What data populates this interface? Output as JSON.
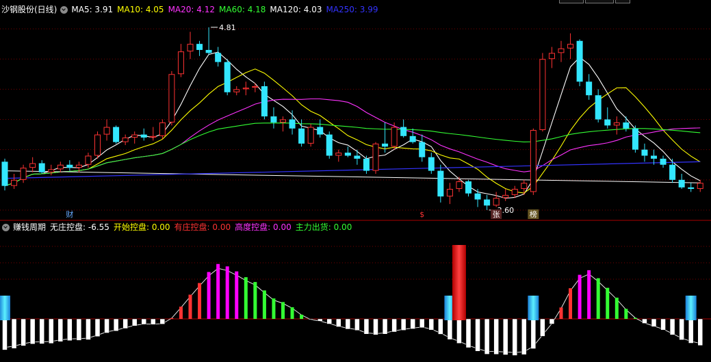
{
  "title": "沙钢股份(日线)",
  "ma_legend": [
    {
      "label": "MA5: 3.91",
      "color": "#ffffff"
    },
    {
      "label": "MA10: 4.05",
      "color": "#ffff00"
    },
    {
      "label": "MA20: 4.12",
      "color": "#ff33ff"
    },
    {
      "label": "MA60: 4.18",
      "color": "#33ff33"
    },
    {
      "label": "MA120: 4.03",
      "color": "#ffffff"
    },
    {
      "label": "MA250: 3.99",
      "color": "#3333ff"
    }
  ],
  "indicator": {
    "name": "赚钱周期",
    "fields": [
      {
        "label": "无庄控盘:",
        "value": "-6.55",
        "color": "#ffffff"
      },
      {
        "label": "开始控盘:",
        "value": "0.00",
        "color": "#ffff00"
      },
      {
        "label": "有庄控盘:",
        "value": "0.00",
        "color": "#ff3333"
      },
      {
        "label": "高度控盘:",
        "value": "0.00",
        "color": "#ff33ff"
      },
      {
        "label": "主力出货:",
        "value": "0.00",
        "color": "#33ff33"
      }
    ]
  },
  "colors": {
    "up": "#ff3333",
    "down": "#33e6ff",
    "grid": "#7a0000",
    "purple": "#ff00ff"
  },
  "chart_data": [
    {
      "type": "candlestick",
      "ylim": [
        3.55,
        4.9
      ],
      "annotations": {
        "high": "4.81",
        "low": "3.60"
      },
      "markers": [
        {
          "index": 7,
          "label": "财",
          "color": "#66aaff"
        },
        {
          "index": 45,
          "label": "$",
          "color": "#ff3333"
        },
        {
          "index": 53,
          "label": "张",
          "color": "#ffffff",
          "bg": "#552222"
        },
        {
          "index": 57,
          "label": "榜",
          "color": "#ffffff",
          "bg": "#665522"
        }
      ],
      "candles": [
        [
          3.92,
          3.94,
          3.73,
          3.76
        ],
        [
          3.76,
          3.84,
          3.74,
          3.8
        ],
        [
          3.8,
          3.9,
          3.78,
          3.88
        ],
        [
          3.88,
          3.95,
          3.85,
          3.91
        ],
        [
          3.91,
          3.93,
          3.84,
          3.85
        ],
        [
          3.85,
          3.9,
          3.83,
          3.87
        ],
        [
          3.87,
          3.92,
          3.85,
          3.9
        ],
        [
          3.9,
          3.93,
          3.86,
          3.88
        ],
        [
          3.88,
          3.92,
          3.85,
          3.9
        ],
        [
          3.9,
          3.98,
          3.88,
          3.96
        ],
        [
          3.96,
          4.12,
          3.94,
          4.1
        ],
        [
          4.1,
          4.2,
          4.06,
          4.15
        ],
        [
          4.15,
          4.16,
          4.04,
          4.05
        ],
        [
          4.05,
          4.1,
          4.03,
          4.08
        ],
        [
          4.08,
          4.12,
          4.04,
          4.1
        ],
        [
          4.1,
          4.14,
          4.06,
          4.08
        ],
        [
          4.08,
          4.15,
          4.06,
          4.09
        ],
        [
          4.09,
          4.2,
          4.07,
          4.18
        ],
        [
          4.18,
          4.52,
          4.16,
          4.5
        ],
        [
          4.5,
          4.7,
          4.48,
          4.65
        ],
        [
          4.65,
          4.78,
          4.6,
          4.7
        ],
        [
          4.7,
          4.72,
          4.62,
          4.66
        ],
        [
          4.66,
          4.81,
          4.63,
          4.64
        ],
        [
          4.64,
          4.68,
          4.55,
          4.58
        ],
        [
          4.58,
          4.6,
          4.36,
          4.38
        ],
        [
          4.38,
          4.42,
          4.36,
          4.4
        ],
        [
          4.4,
          4.45,
          4.36,
          4.41
        ],
        [
          4.41,
          4.44,
          4.38,
          4.42
        ],
        [
          4.42,
          4.45,
          4.2,
          4.22
        ],
        [
          4.22,
          4.28,
          4.14,
          4.18
        ],
        [
          4.18,
          4.22,
          4.12,
          4.2
        ],
        [
          4.2,
          4.26,
          4.1,
          4.14
        ],
        [
          4.14,
          4.2,
          4.02,
          4.04
        ],
        [
          4.04,
          4.17,
          4.02,
          4.15
        ],
        [
          4.15,
          4.2,
          4.08,
          4.1
        ],
        [
          4.1,
          4.12,
          3.94,
          3.96
        ],
        [
          3.96,
          4.0,
          3.92,
          3.98
        ],
        [
          3.98,
          4.02,
          3.95,
          3.96
        ],
        [
          3.96,
          4.0,
          3.9,
          3.94
        ],
        [
          3.94,
          3.96,
          3.84,
          3.86
        ],
        [
          3.86,
          4.05,
          3.84,
          4.04
        ],
        [
          4.04,
          4.18,
          3.98,
          4.02
        ],
        [
          4.02,
          4.18,
          4.0,
          4.15
        ],
        [
          4.15,
          4.2,
          4.08,
          4.09
        ],
        [
          4.09,
          4.14,
          4.04,
          4.05
        ],
        [
          4.05,
          4.1,
          3.92,
          3.95
        ],
        [
          3.95,
          3.98,
          3.84,
          3.86
        ],
        [
          3.86,
          3.9,
          3.65,
          3.69
        ],
        [
          3.69,
          3.78,
          3.64,
          3.74
        ],
        [
          3.74,
          3.82,
          3.72,
          3.79
        ],
        [
          3.79,
          3.8,
          3.69,
          3.71
        ],
        [
          3.71,
          3.74,
          3.62,
          3.67
        ],
        [
          3.67,
          3.7,
          3.6,
          3.63
        ],
        [
          3.63,
          3.72,
          3.62,
          3.68
        ],
        [
          3.68,
          3.74,
          3.66,
          3.7
        ],
        [
          3.7,
          3.76,
          3.68,
          3.74
        ],
        [
          3.74,
          3.8,
          3.7,
          3.78
        ],
        [
          3.72,
          4.14,
          3.7,
          4.13
        ],
        [
          4.13,
          4.64,
          4.12,
          4.6
        ],
        [
          4.6,
          4.68,
          4.54,
          4.64
        ],
        [
          4.64,
          4.72,
          4.58,
          4.67
        ],
        [
          4.67,
          4.77,
          4.6,
          4.7
        ],
        [
          4.72,
          4.73,
          4.42,
          4.45
        ],
        [
          4.45,
          4.5,
          4.33,
          4.36
        ],
        [
          4.36,
          4.4,
          4.18,
          4.2
        ],
        [
          4.2,
          4.28,
          4.14,
          4.16
        ],
        [
          4.16,
          4.22,
          4.1,
          4.18
        ],
        [
          4.18,
          4.22,
          4.12,
          4.14
        ],
        [
          4.14,
          4.16,
          3.98,
          4.0
        ],
        [
          4.0,
          4.04,
          3.92,
          3.96
        ],
        [
          3.96,
          4.0,
          3.9,
          3.94
        ],
        [
          3.94,
          3.96,
          3.88,
          3.9
        ],
        [
          3.9,
          3.94,
          3.78,
          3.8
        ],
        [
          3.8,
          3.84,
          3.74,
          3.75
        ],
        [
          3.75,
          3.78,
          3.72,
          3.74
        ],
        [
          3.74,
          3.8,
          3.72,
          3.78
        ]
      ],
      "ma120": [
        3.86,
        3.78
      ],
      "ma250": [
        3.81,
        3.92
      ]
    },
    {
      "type": "bar",
      "name": "赚钱周期",
      "ylim": [
        -1.0,
        1.0
      ],
      "legend_note": "black/white = 无庄控盘, yellow = 开始控盘, red = 有庄控盘, magenta = 高度控盘, green = 主力出货, cyan = signal"
    }
  ]
}
